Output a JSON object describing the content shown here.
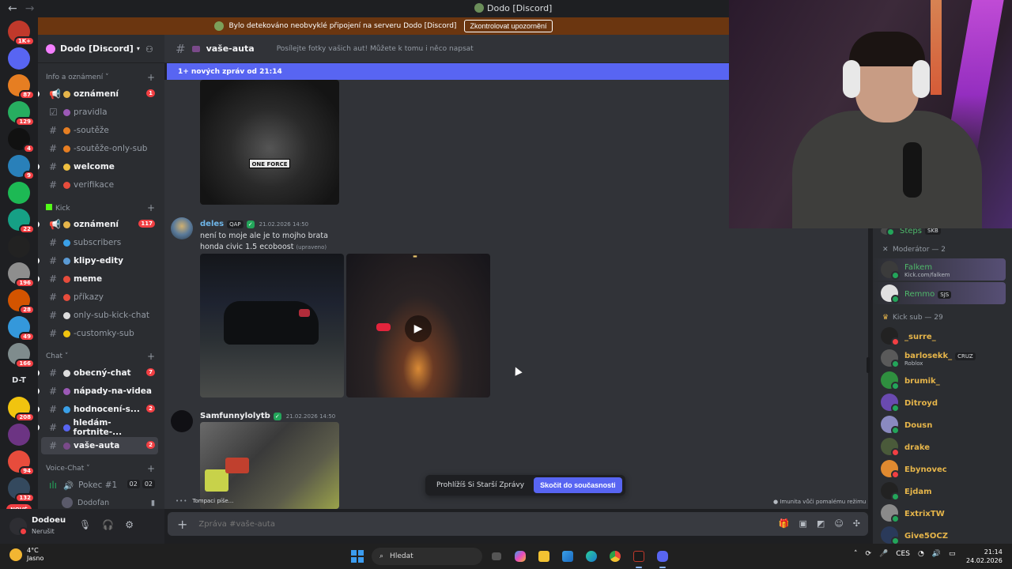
{
  "window": {
    "title": "Dodo [Discord]",
    "back": "←",
    "forward": "→"
  },
  "banner": {
    "text": "Bylo detekováno neobvyklé připojení na serveru Dodo [Discord]",
    "button": "Zkontrolovat upozornění"
  },
  "guilds": [
    {
      "color": "#c0392b",
      "badge": "1K+"
    },
    {
      "color": "#5865f2",
      "badge": ""
    },
    {
      "color": "#e67e22",
      "badge": "87"
    },
    {
      "color": "#27ae60",
      "badge": "129"
    },
    {
      "color": "#111111",
      "badge": "4"
    },
    {
      "color": "#2980b9",
      "badge": "9"
    },
    {
      "color": "#1db954",
      "badge": ""
    },
    {
      "color": "#16a085",
      "badge": "22"
    },
    {
      "color": "#222222",
      "badge": ""
    },
    {
      "color": "#8e8e8e",
      "badge": "196"
    },
    {
      "color": "#d35400",
      "badge": "28"
    },
    {
      "color": "#3498db",
      "badge": "49"
    },
    {
      "color": "#7f8c8d",
      "badge": "166"
    },
    {
      "text": "D-T"
    },
    {
      "color": "#f1c40f",
      "badge": "208"
    },
    {
      "color": "#6c3483",
      "badge": ""
    },
    {
      "color": "#e74c3c",
      "badge": "94"
    },
    {
      "color": "#34495e",
      "badge": "132"
    }
  ],
  "guild_new": "NOVÉ",
  "server": {
    "name": "Dodo [Discord]"
  },
  "categories": {
    "info": "Info a oznámení",
    "kick": "Kick",
    "chat": "Chat",
    "voice": "Voice-Chat"
  },
  "channels_info": [
    {
      "name": "oznámení",
      "emoji": "#e6b54a",
      "unread": true,
      "mention": "1",
      "type": "announce"
    },
    {
      "name": "pravidla",
      "emoji": "#9b59b6",
      "unread": false,
      "type": "rules"
    },
    {
      "name": "-soutěže",
      "emoji": "#e67e22",
      "unread": false
    },
    {
      "name": "-soutěže-only-sub",
      "emoji": "#e67e22",
      "unread": false
    },
    {
      "name": "welcome",
      "emoji": "#f0c040",
      "unread": true
    },
    {
      "name": "verifikace",
      "emoji": "#e74c3c",
      "unread": false
    }
  ],
  "channels_kick": [
    {
      "name": "oznámení",
      "emoji": "#e6b54a",
      "unread": true,
      "mention": "117",
      "type": "announce"
    },
    {
      "name": "subscribers",
      "emoji": "#3aa0e8",
      "unread": false
    },
    {
      "name": "klipy-edity",
      "emoji": "#5b9bd5",
      "unread": true
    },
    {
      "name": "meme",
      "emoji": "#e74c3c",
      "unread": true
    },
    {
      "name": "příkazy",
      "emoji": "#e74c3c",
      "unread": false
    },
    {
      "name": "only-sub-kick-chat",
      "emoji": "#dddddd",
      "unread": false
    },
    {
      "name": "-customky-sub",
      "emoji": "#f1c40f",
      "unread": false
    }
  ],
  "channels_chat": [
    {
      "name": "obecný-chat",
      "emoji": "#dddddd",
      "unread": true,
      "mention": "7"
    },
    {
      "name": "nápady-na-videa",
      "emoji": "#9b59b6",
      "unread": true
    },
    {
      "name": "hodnocení-s...",
      "emoji": "#3aa0e8",
      "unread": true,
      "mention": "2"
    },
    {
      "name": "hledám-fortnite-...",
      "emoji": "#5865f2",
      "unread": true
    },
    {
      "name": "vaše-auta",
      "emoji": "#7a4a8a",
      "unread": true,
      "mention": "2",
      "active": true
    }
  ],
  "voice": {
    "channel": "Pokec #1",
    "count_a": "02",
    "count_b": "02",
    "users": [
      "Dodofan"
    ]
  },
  "user": {
    "name": "Dodoeu",
    "status": "Nerušit"
  },
  "chat": {
    "channel": "vaše-auta",
    "topic": "Posílejte fotky vašich aut! Můžete k tomu i něco napsat",
    "new_messages": "1+ nových zpráv od 21:14"
  },
  "messages": [
    {
      "author": "deles",
      "tag": "QAP",
      "verified": "✓",
      "timestamp": "21.02.2026 14:50",
      "lines": [
        "není to moje ale je to mojho brata",
        "honda civic 1.5 ecoboost"
      ],
      "edited": "(upraveno)"
    },
    {
      "author": "Samfunnylolytb",
      "verified": "✓",
      "timestamp": "21.02.2026 14:50"
    }
  ],
  "plate_text": "ONE FORCE",
  "typing": "Tompaci píše...",
  "slowmode": "Imunita vůči pomalému režimu",
  "jump": {
    "label": "Prohlížíš Si Starší Zprávy",
    "button": "Skočit do současnosti"
  },
  "composer": {
    "placeholder": "Zpráva #vaše-auta"
  },
  "members": {
    "top_name": "Steps",
    "top_tag": "SKB",
    "mod_header": "Moderátor — 2",
    "mods": [
      {
        "name": "Falkem",
        "sub": "Kick.com/falkem",
        "color": "#3b3b3b"
      },
      {
        "name": "Remmo",
        "tag": "SJS",
        "color": "#e0e0e0"
      }
    ],
    "sub_header": "Kick sub — 29",
    "subs": [
      {
        "name": "_surre_",
        "color": "#222222",
        "status": "#f23f43"
      },
      {
        "name": "barlosekk_",
        "tag": "CRUZ",
        "sub": "Roblox",
        "color": "#5a5a5a",
        "status": "#23a55a"
      },
      {
        "name": "brumik_",
        "color": "#2f8f3f",
        "status": "#23a55a"
      },
      {
        "name": "Ditroyd",
        "color": "#6a4ab0",
        "status": "#23a55a"
      },
      {
        "name": "Dousn",
        "color": "#8a8ac0",
        "status": "#23a55a"
      },
      {
        "name": "drake",
        "color": "#4a5a3a",
        "status": "#f23f43"
      },
      {
        "name": "Ebynovec",
        "color": "#e08a30",
        "status": "#f23f43"
      },
      {
        "name": "Ejdam",
        "color": "#222222",
        "status": "#23a55a"
      },
      {
        "name": "ExtrixTW",
        "color": "#8a8a8a",
        "status": "#23a55a"
      },
      {
        "name": "Give5OCZ",
        "color": "#2a3a5a",
        "status": "#23a55a"
      }
    ]
  },
  "taskbar": {
    "temp": "4°C",
    "weather": "Jasno",
    "search": "Hledat",
    "lang": "CES",
    "time": "21:14",
    "date": "24.02.2026"
  },
  "colors": {
    "accent": "#5865f2",
    "banner": "#6b3610",
    "gold": "#e6b54a",
    "green": "#23a55a",
    "red": "#f23f43"
  }
}
